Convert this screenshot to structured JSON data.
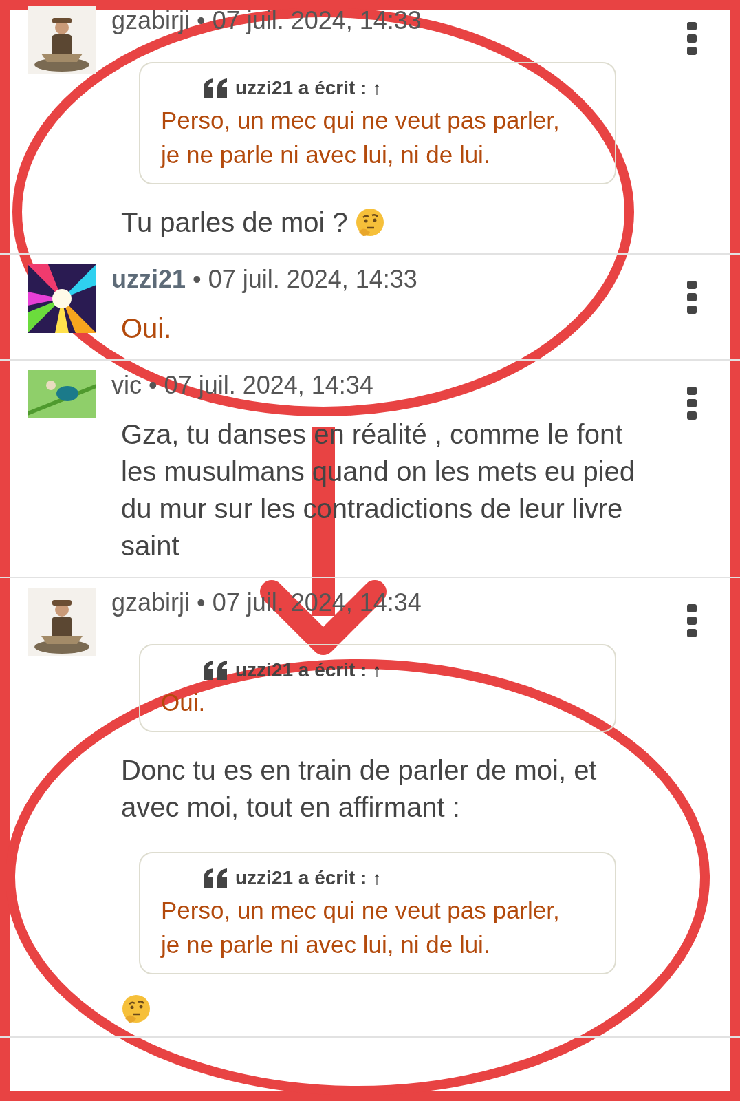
{
  "posts": [
    {
      "author": "gzabirji",
      "author_highlight": false,
      "timestamp": "• 07 juil. 2024, 14:33",
      "blocks": [
        {
          "kind": "quote",
          "author": "uzzi21 a écrit :",
          "link": "↑",
          "text": "Perso, un mec qui ne veut pas parler, je ne parle ni avec lui, ni de lui."
        },
        {
          "kind": "text",
          "text": "Tu parles de moi ?",
          "emoji": true
        }
      ]
    },
    {
      "author": "uzzi21",
      "author_highlight": true,
      "timestamp": "• 07 juil. 2024, 14:33",
      "blocks": [
        {
          "kind": "highlight",
          "text": "Oui.",
          "emoji": false
        }
      ]
    },
    {
      "author": "vic",
      "author_highlight": false,
      "timestamp": "• 07 juil. 2024, 14:34",
      "blocks": [
        {
          "kind": "text",
          "text": "Gza, tu danses en réalité , comme le font les musulmans quand on les mets eu pied du mur sur les contradictions de leur livre saint",
          "emoji": false
        }
      ]
    },
    {
      "author": "gzabirji",
      "author_highlight": false,
      "timestamp": "• 07 juil. 2024, 14:34",
      "blocks": [
        {
          "kind": "quote",
          "author": "uzzi21 a écrit :",
          "link": "↑",
          "text": "Oui."
        },
        {
          "kind": "text",
          "text": "Donc tu es en train de parler de moi, et avec moi, tout en affirmant :",
          "emoji": false
        },
        {
          "kind": "quote",
          "author": "uzzi21 a écrit :",
          "link": "↑",
          "text": "Perso, un mec qui ne veut pas parler, je ne parle ni avec lui, ni de lui."
        },
        {
          "kind": "emoji_only"
        }
      ]
    }
  ]
}
